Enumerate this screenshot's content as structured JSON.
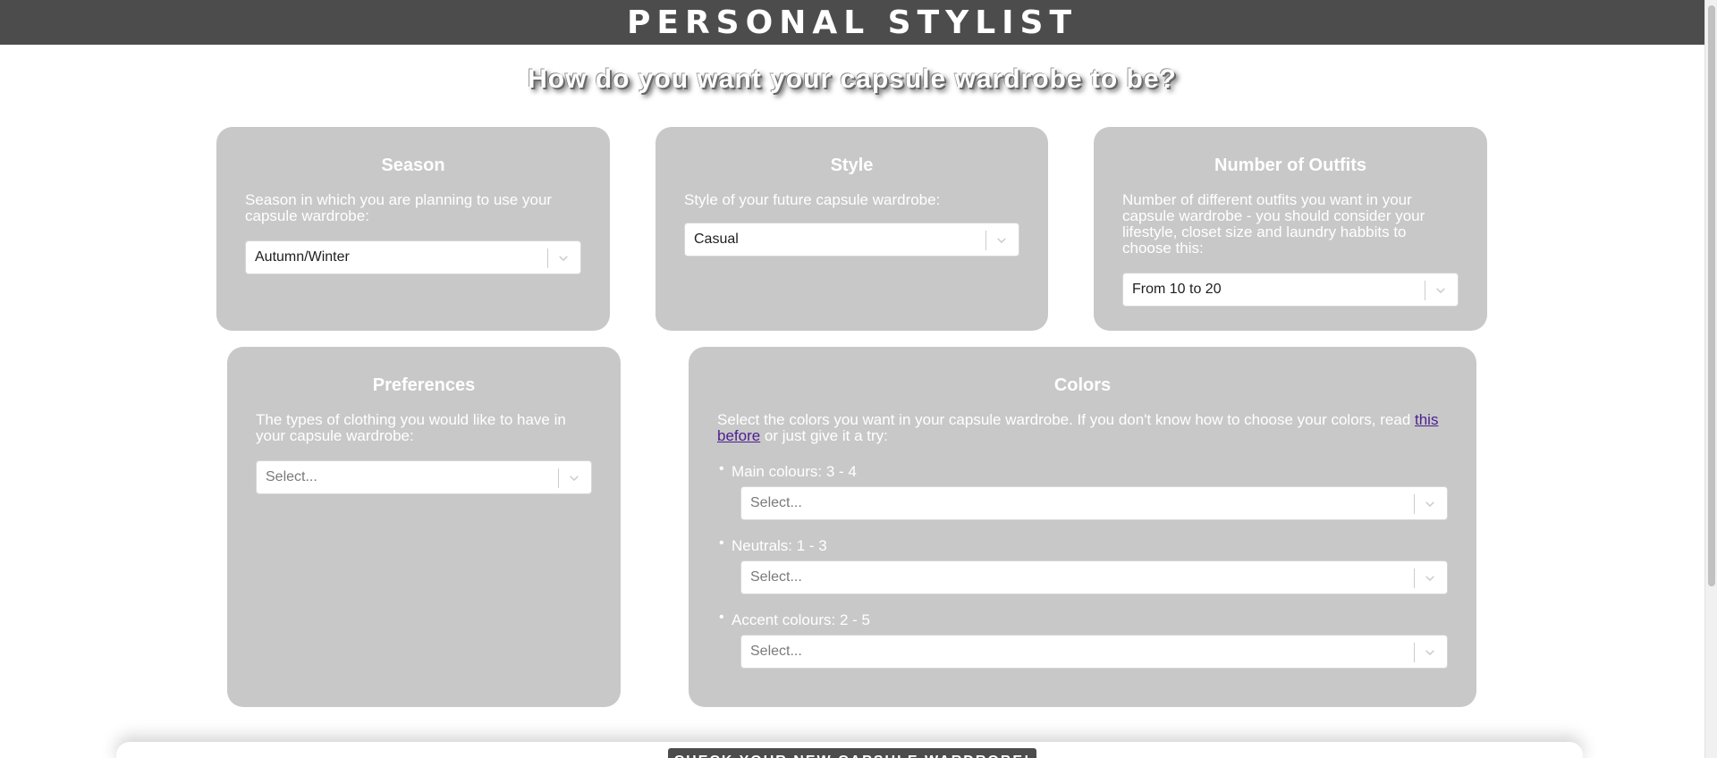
{
  "header": {
    "title": "PERSONAL STYLIST"
  },
  "subtitle": "How do you want your capsule wardrobe to be?",
  "cards": {
    "season": {
      "title": "Season",
      "description": "Season in which you are planning to use your capsule wardrobe:",
      "select_value": "Autumn/Winter"
    },
    "style": {
      "title": "Style",
      "description": "Style of your future capsule wardrobe:",
      "select_value": "Casual"
    },
    "outfits": {
      "title": "Number of Outfits",
      "description": "Number of different outfits you want in your capsule wardrobe - you should consider your lifestyle, closet size and laundry habbits to choose this:",
      "select_value": "From 10 to 20"
    },
    "preferences": {
      "title": "Preferences",
      "description": "The types of clothing you would like to have in your capsule wardrobe:",
      "select_placeholder": "Select..."
    },
    "colors": {
      "title": "Colors",
      "description_before": "Select the colors you want in your capsule wardrobe. If you don't know how to choose your colors, read ",
      "link_text": "this before",
      "description_after": " or just give it a try:",
      "items": [
        {
          "label": "Main colours: 3 - 4",
          "placeholder": "Select..."
        },
        {
          "label": "Neutrals: 1 - 3",
          "placeholder": "Select..."
        },
        {
          "label": "Accent colours: 2 - 5",
          "placeholder": "Select..."
        }
      ]
    }
  },
  "submit_button": "CHECK YOUR NEW CAPSULE WARDROBE!",
  "colors_palette": {
    "header_bg": "#4c4c4c",
    "card_bg": "#c8c8c8",
    "link": "#4b1f8f"
  },
  "icons": {
    "dropdown": "chevron-down-icon"
  }
}
